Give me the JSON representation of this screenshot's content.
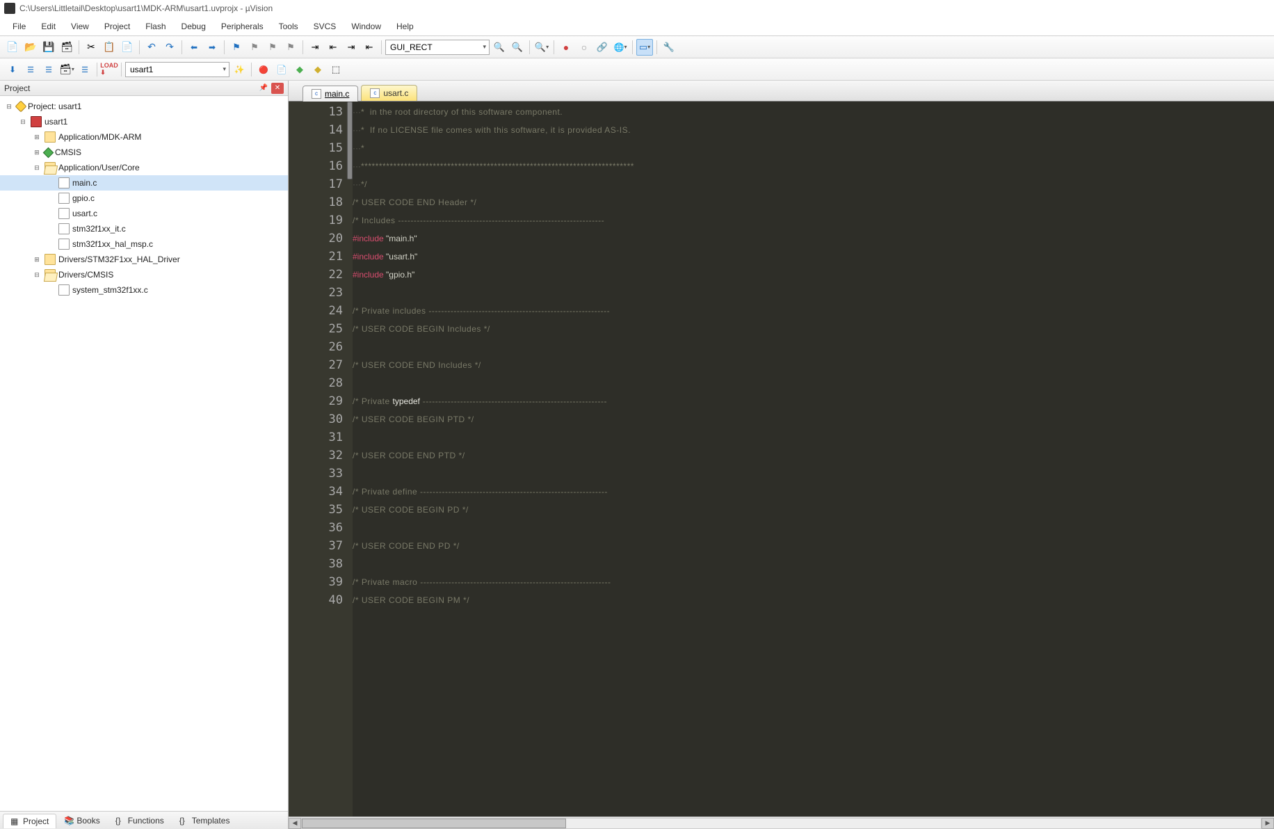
{
  "title": "C:\\Users\\Littletail\\Desktop\\usart1\\MDK-ARM\\usart1.uvprojx - µVision",
  "menu": [
    "File",
    "Edit",
    "View",
    "Project",
    "Flash",
    "Debug",
    "Peripherals",
    "Tools",
    "SVCS",
    "Window",
    "Help"
  ],
  "toolbar1_combo": "GUI_RECT",
  "toolbar2_combo": "usart1",
  "project_header": "Project",
  "tree": {
    "root": "Project: usart1",
    "target": "usart1",
    "groups": [
      {
        "name": "Application/MDK-ARM",
        "expanded": false,
        "files": []
      },
      {
        "name": "CMSIS",
        "expanded": false,
        "files": [],
        "icon": "green-diamond"
      },
      {
        "name": "Application/User/Core",
        "expanded": true,
        "files": [
          "main.c",
          "gpio.c",
          "usart.c",
          "stm32f1xx_it.c",
          "stm32f1xx_hal_msp.c"
        ]
      },
      {
        "name": "Drivers/STM32F1xx_HAL_Driver",
        "expanded": false,
        "files": []
      },
      {
        "name": "Drivers/CMSIS",
        "expanded": true,
        "files": [
          "system_stm32f1xx.c"
        ]
      }
    ]
  },
  "bottom_tabs": [
    "Project",
    "Books",
    "Functions",
    "Templates"
  ],
  "editor_tabs": [
    {
      "label": "main.c",
      "active": true
    },
    {
      "label": "usart.c",
      "active": false
    }
  ],
  "code": {
    "first_line": 13,
    "lines": [
      {
        "n": 13,
        "segs": [
          {
            "t": "···",
            "c": "dot"
          },
          {
            "t": "*  in the root directory of this software component.",
            "c": "c-comment"
          }
        ]
      },
      {
        "n": 14,
        "segs": [
          {
            "t": "···",
            "c": "dot"
          },
          {
            "t": "*  If no LICENSE file comes with this software, it is provided AS-IS.",
            "c": "c-comment"
          }
        ]
      },
      {
        "n": 15,
        "segs": [
          {
            "t": "···",
            "c": "dot"
          },
          {
            "t": "*",
            "c": "c-comment"
          }
        ]
      },
      {
        "n": 16,
        "segs": [
          {
            "t": "···",
            "c": "dot"
          },
          {
            "t": "****************************************************************************",
            "c": "c-comment"
          }
        ]
      },
      {
        "n": 17,
        "segs": [
          {
            "t": "···",
            "c": "dot"
          },
          {
            "t": "*/",
            "c": "c-comment"
          }
        ]
      },
      {
        "n": 18,
        "segs": [
          {
            "t": "/* USER CODE END Header */",
            "c": "c-comment"
          }
        ]
      },
      {
        "n": 19,
        "segs": [
          {
            "t": "/* Includes ------------------------------------------------------------------",
            "c": "c-comment"
          }
        ]
      },
      {
        "n": 20,
        "segs": [
          {
            "t": "#include ",
            "c": "c-keyword"
          },
          {
            "t": "\"main.h\"",
            "c": "c-string"
          }
        ]
      },
      {
        "n": 21,
        "segs": [
          {
            "t": "#include ",
            "c": "c-keyword"
          },
          {
            "t": "\"usart.h\"",
            "c": "c-string"
          }
        ]
      },
      {
        "n": 22,
        "segs": [
          {
            "t": "#include ",
            "c": "c-keyword"
          },
          {
            "t": "\"gpio.h\"",
            "c": "c-string"
          }
        ]
      },
      {
        "n": 23,
        "segs": []
      },
      {
        "n": 24,
        "segs": [
          {
            "t": "/* Private includes ----------------------------------------------------------",
            "c": "c-comment"
          }
        ]
      },
      {
        "n": 25,
        "segs": [
          {
            "t": "/* USER CODE BEGIN Includes */",
            "c": "c-comment"
          }
        ]
      },
      {
        "n": 26,
        "segs": []
      },
      {
        "n": 27,
        "segs": [
          {
            "t": "/* USER CODE END Includes */",
            "c": "c-comment"
          }
        ]
      },
      {
        "n": 28,
        "segs": []
      },
      {
        "n": 29,
        "segs": [
          {
            "t": "/* Private ",
            "c": "c-comment"
          },
          {
            "t": "typedef",
            "c": "c-white"
          },
          {
            "t": " -----------------------------------------------------------",
            "c": "c-comment"
          }
        ]
      },
      {
        "n": 30,
        "segs": [
          {
            "t": "/* USER CODE BEGIN PTD */",
            "c": "c-comment"
          }
        ]
      },
      {
        "n": 31,
        "segs": []
      },
      {
        "n": 32,
        "segs": [
          {
            "t": "/* USER CODE END PTD */",
            "c": "c-comment"
          }
        ]
      },
      {
        "n": 33,
        "segs": []
      },
      {
        "n": 34,
        "segs": [
          {
            "t": "/* Private define ------------------------------------------------------------",
            "c": "c-comment"
          }
        ]
      },
      {
        "n": 35,
        "segs": [
          {
            "t": "/* USER CODE BEGIN PD */",
            "c": "c-comment"
          }
        ]
      },
      {
        "n": 36,
        "segs": []
      },
      {
        "n": 37,
        "segs": [
          {
            "t": "/* USER CODE END PD */",
            "c": "c-comment"
          }
        ]
      },
      {
        "n": 38,
        "segs": []
      },
      {
        "n": 39,
        "segs": [
          {
            "t": "/* Private macro -------------------------------------------------------------",
            "c": "c-comment"
          }
        ]
      },
      {
        "n": 40,
        "segs": [
          {
            "t": "/* USER CODE BEGIN PM */",
            "c": "c-comment"
          }
        ]
      }
    ]
  }
}
